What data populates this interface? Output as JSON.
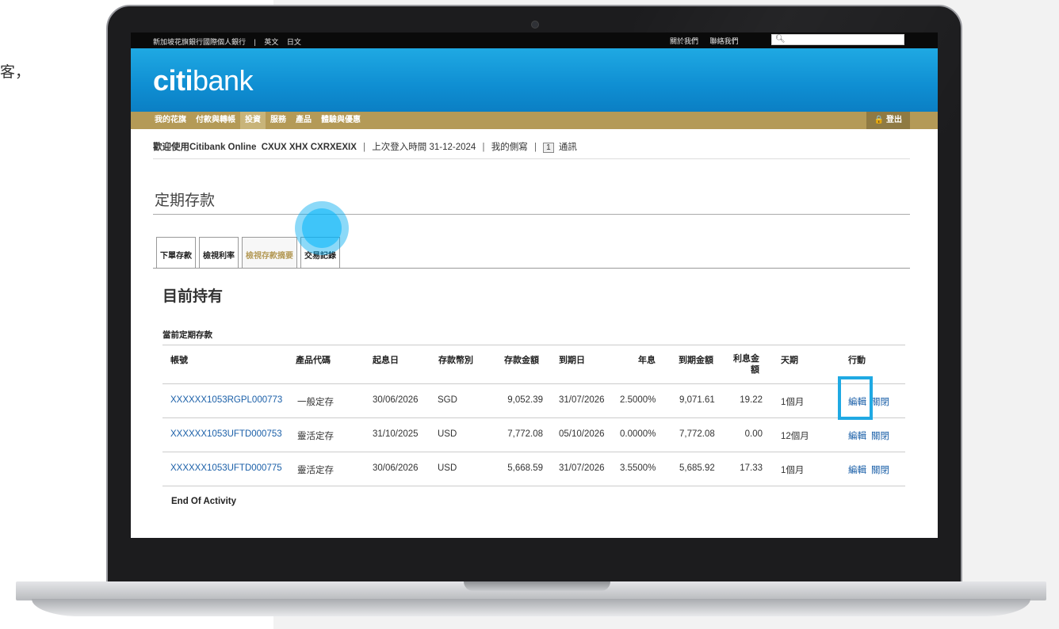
{
  "side_text": "客，",
  "util_bar": {
    "left_items": [
      "新加坡花旗銀行國際個人銀行",
      "|",
      "英文",
      "日文"
    ],
    "right_items": [
      "關於我們",
      "聯絡我們"
    ],
    "search_placeholder": ""
  },
  "brand": {
    "logo_bold": "citi",
    "logo_light": "bank"
  },
  "nav": {
    "items": [
      "我的花旗",
      "付款與轉帳",
      "投資",
      "服務",
      "產品",
      "體驗與優惠"
    ],
    "logout_label": "🔒 登出"
  },
  "welcome": {
    "prefix": "歡迎使用Citibank Online",
    "user": "CXUX XHX CXRXEXIX",
    "last_login": "上次登入時間 31-12-2024",
    "profile": "我的側寫",
    "messages_count": "1",
    "messages_label": "通訊"
  },
  "page_title": "定期存款",
  "tabs": [
    "下單存款",
    "檢視利率",
    "檢視存款摘要",
    "交易記錄"
  ],
  "holdings_title": "目前持有",
  "section_title": "當前定期存款",
  "table": {
    "headers": {
      "account": "帳號",
      "product_code": "產品代碼",
      "start_date": "起息日",
      "currency": "存款幣別",
      "amount": "存款金額",
      "maturity_date": "到期日",
      "rate": "年息",
      "maturity_amount_line": "到期金額",
      "interest_1": "利息金",
      "interest_2": "額",
      "tenor": "天期",
      "action": "行動"
    },
    "rows": [
      {
        "account": "XXXXXX1053RGPL000773",
        "product": "一般定存",
        "start": "30/06/2026",
        "ccy": "SGD",
        "amount": "9,052.39",
        "maturity": "31/07/2026",
        "rate": "2.5000%",
        "mat_amount": "9,071.61",
        "interest": "19.22",
        "tenor": "1個月",
        "edit": "編輯",
        "close": "關閉"
      },
      {
        "account": "XXXXXX1053UFTD000753",
        "product": "靈活定存",
        "start": "31/10/2025",
        "ccy": "USD",
        "amount": "7,772.08",
        "maturity": "05/10/2026",
        "rate": "0.0000%",
        "mat_amount": "7,772.08",
        "interest": "0.00",
        "tenor": "12個月",
        "edit": "編輯",
        "close": "關閉"
      },
      {
        "account": "XXXXXX1053UFTD000775",
        "product": "靈活定存",
        "start": "30/06/2026",
        "ccy": "USD",
        "amount": "5,668.59",
        "maturity": "31/07/2026",
        "rate": "3.5500%",
        "mat_amount": "5,685.92",
        "interest": "17.33",
        "tenor": "1個月",
        "edit": "編輯",
        "close": "關閉"
      }
    ]
  },
  "end_text": "End Of Activity",
  "colors": {
    "brand_blue": "#0f8ed2",
    "nav_gold": "#b49a57",
    "link_blue": "#1a5fa8",
    "highlight": "#1fa9e3"
  }
}
